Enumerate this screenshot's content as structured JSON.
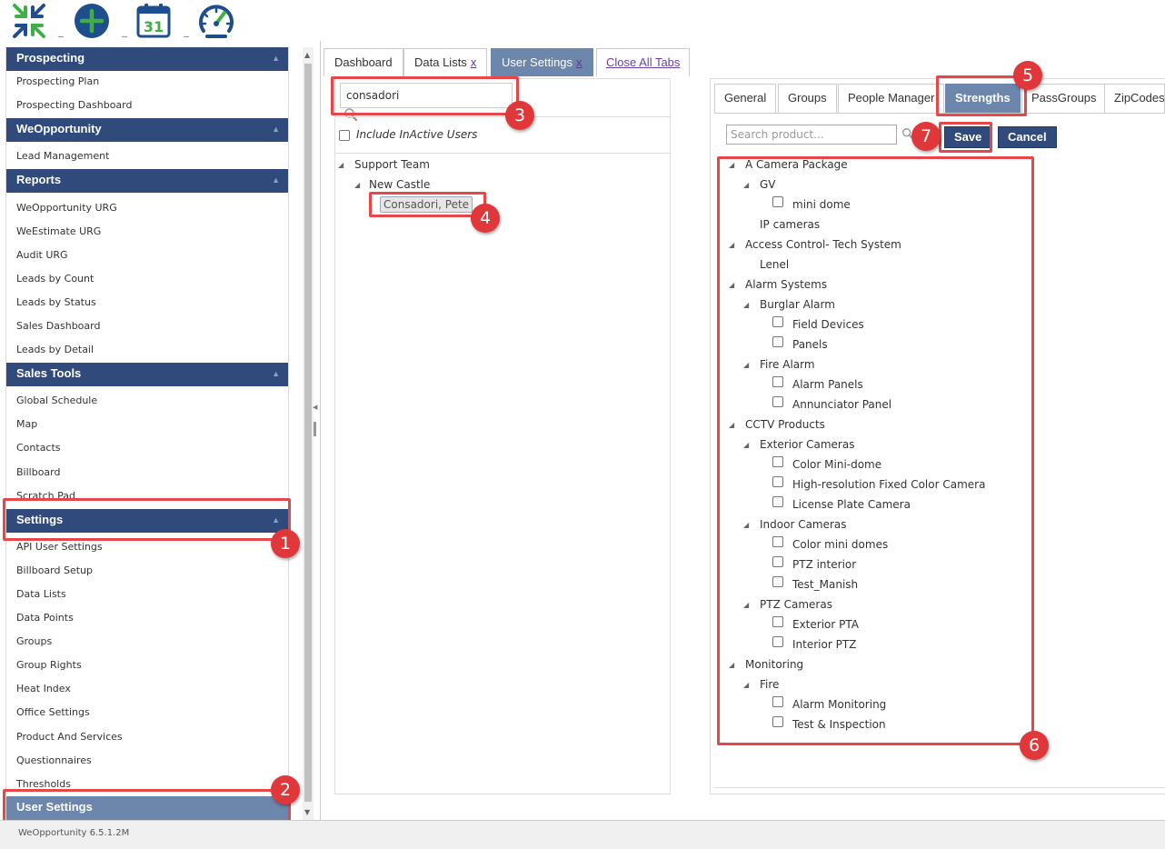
{
  "toolbar": {
    "buttons": [
      {
        "name": "collapse",
        "icon": "collapse-arrows-icon"
      },
      {
        "name": "add",
        "icon": "plus-circle-icon"
      },
      {
        "name": "calendar",
        "icon": "calendar-icon",
        "day": "31"
      },
      {
        "name": "dashboard",
        "icon": "speedometer-icon"
      }
    ],
    "colors": {
      "icon_green": "#3fae49",
      "icon_blue": "#1f4e8c"
    }
  },
  "sidebar": {
    "sections": [
      {
        "title": "Prospecting",
        "items": [
          "Prospecting Plan",
          "Prospecting Dashboard"
        ]
      },
      {
        "title": "WeOpportunity",
        "items": [
          "Lead Management"
        ]
      },
      {
        "title": "Reports",
        "items": [
          "WeOpportunity URG",
          "WeEstimate URG",
          "Audit URG",
          "Leads by Count",
          "Leads by Status",
          "Sales Dashboard",
          "Leads by Detail"
        ]
      },
      {
        "title": "Sales Tools",
        "items": [
          "Global Schedule",
          "Map",
          "Contacts",
          "Billboard",
          "Scratch Pad"
        ]
      },
      {
        "title": "Settings",
        "items": [
          "API User Settings",
          "Billboard Setup",
          "Data Lists",
          "Data Points",
          "Groups",
          "Group Rights",
          "Heat Index",
          "Office Settings",
          "Product And Services",
          "Questionnaires",
          "Thresholds"
        ]
      }
    ],
    "active_item": "User Settings",
    "colors": {
      "header_bg": "#2f4a7b",
      "active_bg": "#6c86ac"
    }
  },
  "tabs": [
    {
      "label": "Dashboard",
      "closable": false
    },
    {
      "label": "Data Lists",
      "closable": true,
      "close": "x"
    },
    {
      "label": "User Settings",
      "closable": true,
      "close": "x",
      "active": true
    }
  ],
  "close_all_tabs": "Close All Tabs",
  "users": {
    "search_value": "consadori",
    "include_inactive_label": "Include InActive Users",
    "tree": {
      "team": "Support Team",
      "office": "New Castle",
      "user": "Consadori, Pete"
    }
  },
  "settings": {
    "tabs": [
      "General",
      "Groups",
      "People Manager",
      "Strengths",
      "PassGroups",
      "ZipCodes"
    ],
    "active_tab": "Strengths",
    "search_placeholder": "Search product...",
    "save_label": "Save",
    "cancel_label": "Cancel",
    "products": [
      {
        "label": "A Camera Package",
        "level": 0,
        "expander": true
      },
      {
        "label": "GV",
        "level": 1,
        "expander": true
      },
      {
        "label": "mini dome",
        "level": 2,
        "checkbox": true
      },
      {
        "label": "IP cameras",
        "level": 1
      },
      {
        "label": "Access Control- Tech System",
        "level": 0,
        "expander": true
      },
      {
        "label": "Lenel",
        "level": 1
      },
      {
        "label": "Alarm Systems",
        "level": 0,
        "expander": true
      },
      {
        "label": "Burglar Alarm",
        "level": 1,
        "expander": true
      },
      {
        "label": "Field Devices",
        "level": 2,
        "checkbox": true
      },
      {
        "label": "Panels",
        "level": 2,
        "checkbox": true
      },
      {
        "label": "Fire Alarm",
        "level": 1,
        "expander": true
      },
      {
        "label": "Alarm Panels",
        "level": 2,
        "checkbox": true
      },
      {
        "label": "Annunciator Panel",
        "level": 2,
        "checkbox": true
      },
      {
        "label": "CCTV Products",
        "level": 0,
        "expander": true
      },
      {
        "label": "Exterior Cameras",
        "level": 1,
        "expander": true
      },
      {
        "label": "Color Mini-dome",
        "level": 2,
        "checkbox": true
      },
      {
        "label": "High-resolution Fixed Color Camera",
        "level": 2,
        "checkbox": true
      },
      {
        "label": "License Plate Camera",
        "level": 2,
        "checkbox": true
      },
      {
        "label": "Indoor Cameras",
        "level": 1,
        "expander": true
      },
      {
        "label": "Color mini domes",
        "level": 2,
        "checkbox": true
      },
      {
        "label": "PTZ interior",
        "level": 2,
        "checkbox": true
      },
      {
        "label": "Test_Manish",
        "level": 2,
        "checkbox": true
      },
      {
        "label": "PTZ Cameras",
        "level": 1,
        "expander": true
      },
      {
        "label": "Exterior PTA",
        "level": 2,
        "checkbox": true
      },
      {
        "label": "Interior PTZ",
        "level": 2,
        "checkbox": true
      },
      {
        "label": "Monitoring",
        "level": 0,
        "expander": true
      },
      {
        "label": "Fire",
        "level": 1,
        "expander": true
      },
      {
        "label": "Alarm Monitoring",
        "level": 2,
        "checkbox": true
      },
      {
        "label": "Test & Inspection",
        "level": 2,
        "checkbox": true
      }
    ]
  },
  "annotations": [
    "1",
    "2",
    "3",
    "4",
    "5",
    "6",
    "7"
  ],
  "annotation_color": "#e8474a",
  "footer": {
    "version": "WeOpportunity 6.5.1.2M"
  }
}
